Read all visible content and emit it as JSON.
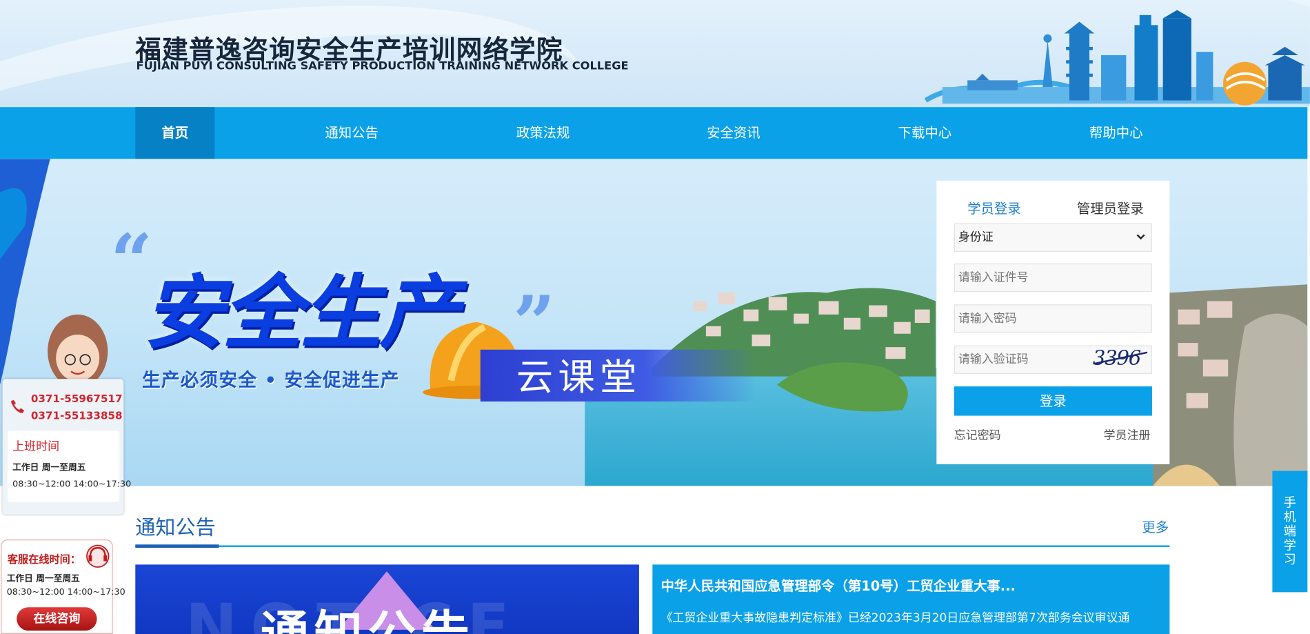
{
  "header": {
    "title_cn": "福建普逸咨询安全生产培训网络学院",
    "title_en": "FUJIAN PUYI CONSULTING SAFETY PRODUCTION TRAINING NETWORK COLLEGE"
  },
  "nav": {
    "items": [
      {
        "label": "首页",
        "active": true
      },
      {
        "label": "通知公告"
      },
      {
        "label": "政策法规"
      },
      {
        "label": "安全资讯"
      },
      {
        "label": "下载中心"
      },
      {
        "label": "帮助中心"
      }
    ]
  },
  "banner": {
    "quote_open": "“",
    "title": "安全生产",
    "quote_close": "”",
    "subtitle": "生产必须安全 • 安全促进生产",
    "cloud_label": "云课堂"
  },
  "login": {
    "tabs": [
      "学员登录",
      "管理员登录"
    ],
    "id_type": "身份证",
    "id_placeholder": "请输入证件号",
    "password_placeholder": "请输入密码",
    "captcha_placeholder": "请输入验证码",
    "captcha_text": "3396",
    "submit_label": "登录",
    "forgot_label": "忘记密码",
    "register_label": "学员注册"
  },
  "contact": {
    "phones": [
      "0371-55967517",
      "0371-55133858"
    ],
    "hours_title": "上班时间",
    "workday": "工作日  周一至周五",
    "hours": "08:30~12:00  14:00~17:30"
  },
  "service": {
    "title": "客服在线时间：",
    "workday": "工作日  周一至周五",
    "hours": "08:30~12:00  14:00~17:30",
    "button": "在线咨询"
  },
  "mobile_tab": [
    "手",
    "机",
    "端",
    "学",
    "习"
  ],
  "notice": {
    "section_title": "通知公告",
    "more_label": "更多",
    "image_text": "通知公告",
    "image_bg_text": "NOTICE",
    "feature_title": "中华人民共和国应急管理部令（第10号）工贸企业重大事...",
    "feature_desc": "《工贸企业重大事故隐患判定标准》已经2023年3月20日应急管理部第7次部务会议审议通"
  },
  "colors": {
    "nav": "#0aa1e8",
    "nav_active": "#0781c6",
    "accent_blue": "#1d62b5",
    "contact_red": "#d2252d"
  }
}
